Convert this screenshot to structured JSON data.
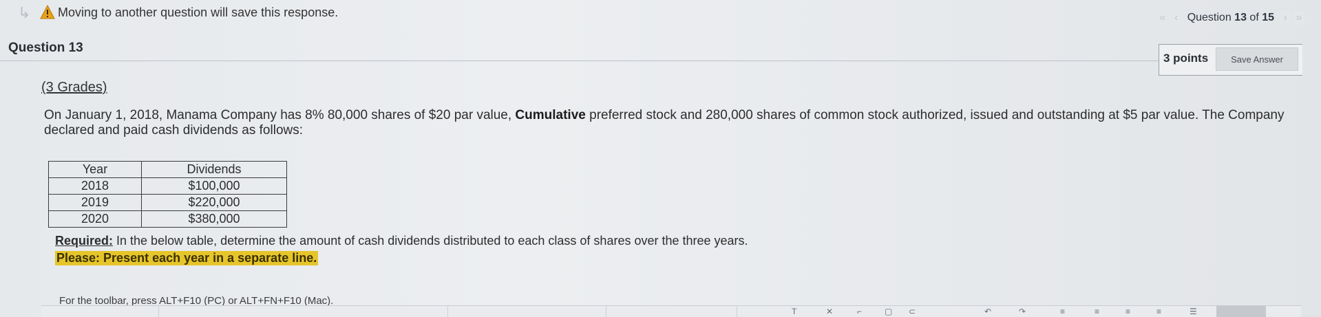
{
  "notice": {
    "text": "Moving to another question will save this response.",
    "icon": "warning-icon"
  },
  "navigation": {
    "prefix": "Question ",
    "current": "13",
    "of_word": " of ",
    "total": "15"
  },
  "question": {
    "title": "Question 13",
    "points": "3 points",
    "save_label": "Save Answer"
  },
  "content": {
    "grades": "(3 Grades)",
    "paragraph_part1": "On January 1, 2018, Manama Company has 8% 80,000 shares of $20 par value, ",
    "paragraph_bold": "Cumulative",
    "paragraph_part2": " preferred stock and 280,000 shares of common stock authorized, issued and outstanding at $5 par value. The Company declared and paid cash dividends as follows:",
    "table": {
      "headers": [
        "Year",
        "Dividends"
      ],
      "rows": [
        [
          "2018",
          "$100,000"
        ],
        [
          "2019",
          "$220,000"
        ],
        [
          "2020",
          "$380,000"
        ]
      ]
    },
    "required_label": "Required:",
    "required_text": " In the below table, determine the amount of cash dividends distributed to each class of shares over the three years.",
    "please_text": "Please: Present each year in a separate line."
  },
  "editor": {
    "hint": "For the toolbar, press ALT+F10 (PC) or ALT+FN+F10 (Mac)."
  },
  "colors": {
    "highlight": "#e6c52a",
    "warning": "#e0a020"
  }
}
